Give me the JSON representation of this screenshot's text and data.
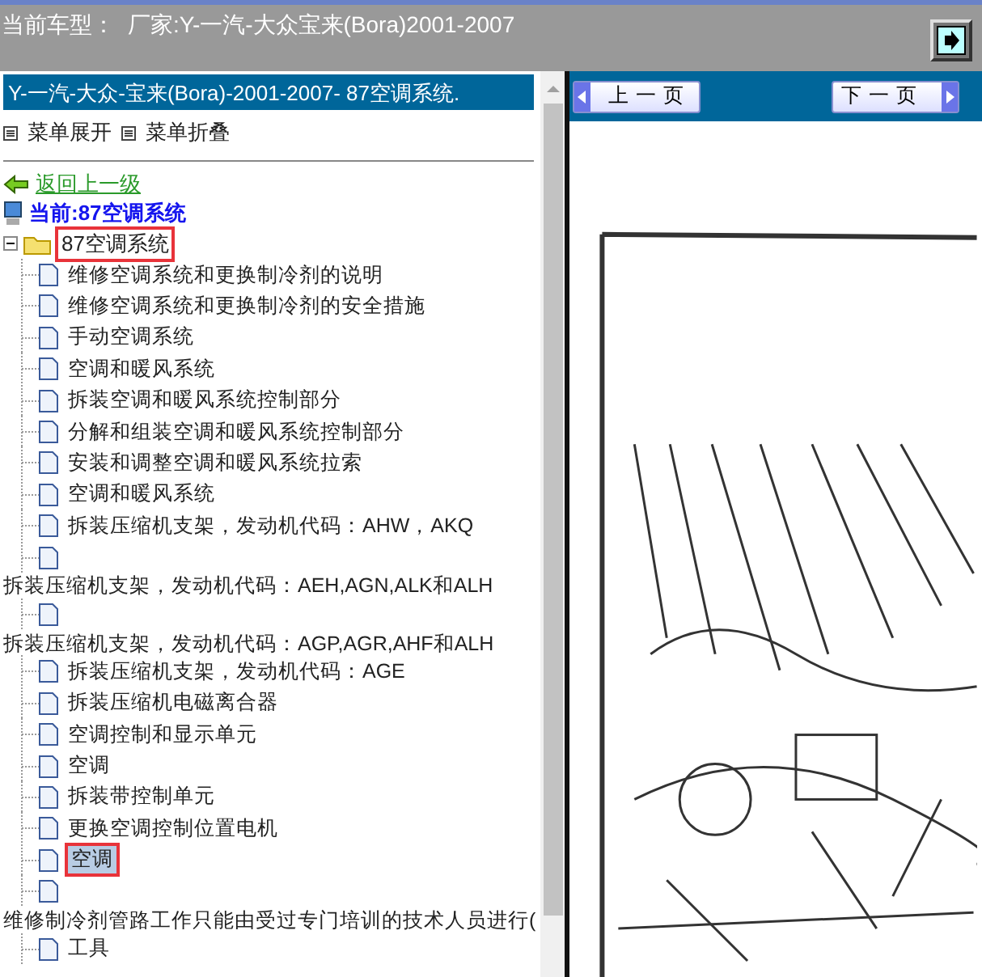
{
  "header": {
    "label": "当前车型：",
    "value": "厂家:Y-一汽-大众宝来(Bora)2001-2007"
  },
  "left_panel": {
    "title": "Y-一汽-大众-宝来(Bora)-2001-2007- 87空调系统.",
    "menu": [
      {
        "label": "菜单展开"
      },
      {
        "label": "菜单折叠"
      }
    ],
    "back_link": "返回上一级",
    "current": "当前:87空调系统",
    "tree": {
      "label": "87空调系统",
      "expanded": true,
      "marked": true,
      "children": [
        {
          "label": "维修空调系统和更换制冷剂的说明",
          "kind": "inline",
          "selected": false,
          "marked": false
        },
        {
          "label": "维修空调系统和更换制冷剂的安全措施",
          "kind": "inline",
          "selected": false,
          "marked": false
        },
        {
          "label": "手动空调系统",
          "kind": "inline",
          "selected": false,
          "marked": false
        },
        {
          "label": "空调和暖风系统",
          "kind": "inline",
          "selected": false,
          "marked": false
        },
        {
          "label": "拆装空调和暖风系统控制部分",
          "kind": "inline",
          "selected": false,
          "marked": false
        },
        {
          "label": "分解和组装空调和暖风系统控制部分",
          "kind": "inline",
          "selected": false,
          "marked": false
        },
        {
          "label": "安装和调整空调和暖风系统拉索",
          "kind": "inline",
          "selected": false,
          "marked": false
        },
        {
          "label": "空调和暖风系统",
          "kind": "inline",
          "selected": false,
          "marked": false
        },
        {
          "label": "拆装压缩机支架，发动机代码：AHW，AKQ",
          "kind": "inline",
          "selected": false,
          "marked": false
        },
        {
          "label": "拆装压缩机支架，发动机代码：AEH,AGN,ALK和ALH",
          "kind": "wrapped",
          "selected": false,
          "marked": false
        },
        {
          "label": "拆装压缩机支架，发动机代码：AGP,AGR,AHF和ALH",
          "kind": "wrapped",
          "selected": false,
          "marked": false
        },
        {
          "label": "拆装压缩机支架，发动机代码：AGE",
          "kind": "inline",
          "selected": false,
          "marked": false
        },
        {
          "label": "拆装压缩机电磁离合器",
          "kind": "inline",
          "selected": false,
          "marked": false
        },
        {
          "label": "空调控制和显示单元",
          "kind": "inline",
          "selected": false,
          "marked": false
        },
        {
          "label": "空调",
          "kind": "inline",
          "selected": false,
          "marked": false
        },
        {
          "label": "拆装带控制单元",
          "kind": "inline",
          "selected": false,
          "marked": false
        },
        {
          "label": "更换空调控制位置电机",
          "kind": "inline",
          "selected": false,
          "marked": false
        },
        {
          "label": "空调",
          "kind": "inline",
          "selected": true,
          "marked": true
        },
        {
          "label": "维修制冷剂管路工作只能由受过专门培训的技术人员进行(",
          "kind": "wrapped",
          "selected": false,
          "marked": false
        },
        {
          "label": "工具",
          "kind": "inline",
          "selected": false,
          "marked": false
        }
      ]
    }
  },
  "right_panel": {
    "prev_button": "上 一 页",
    "next_button": "下 一 页"
  }
}
